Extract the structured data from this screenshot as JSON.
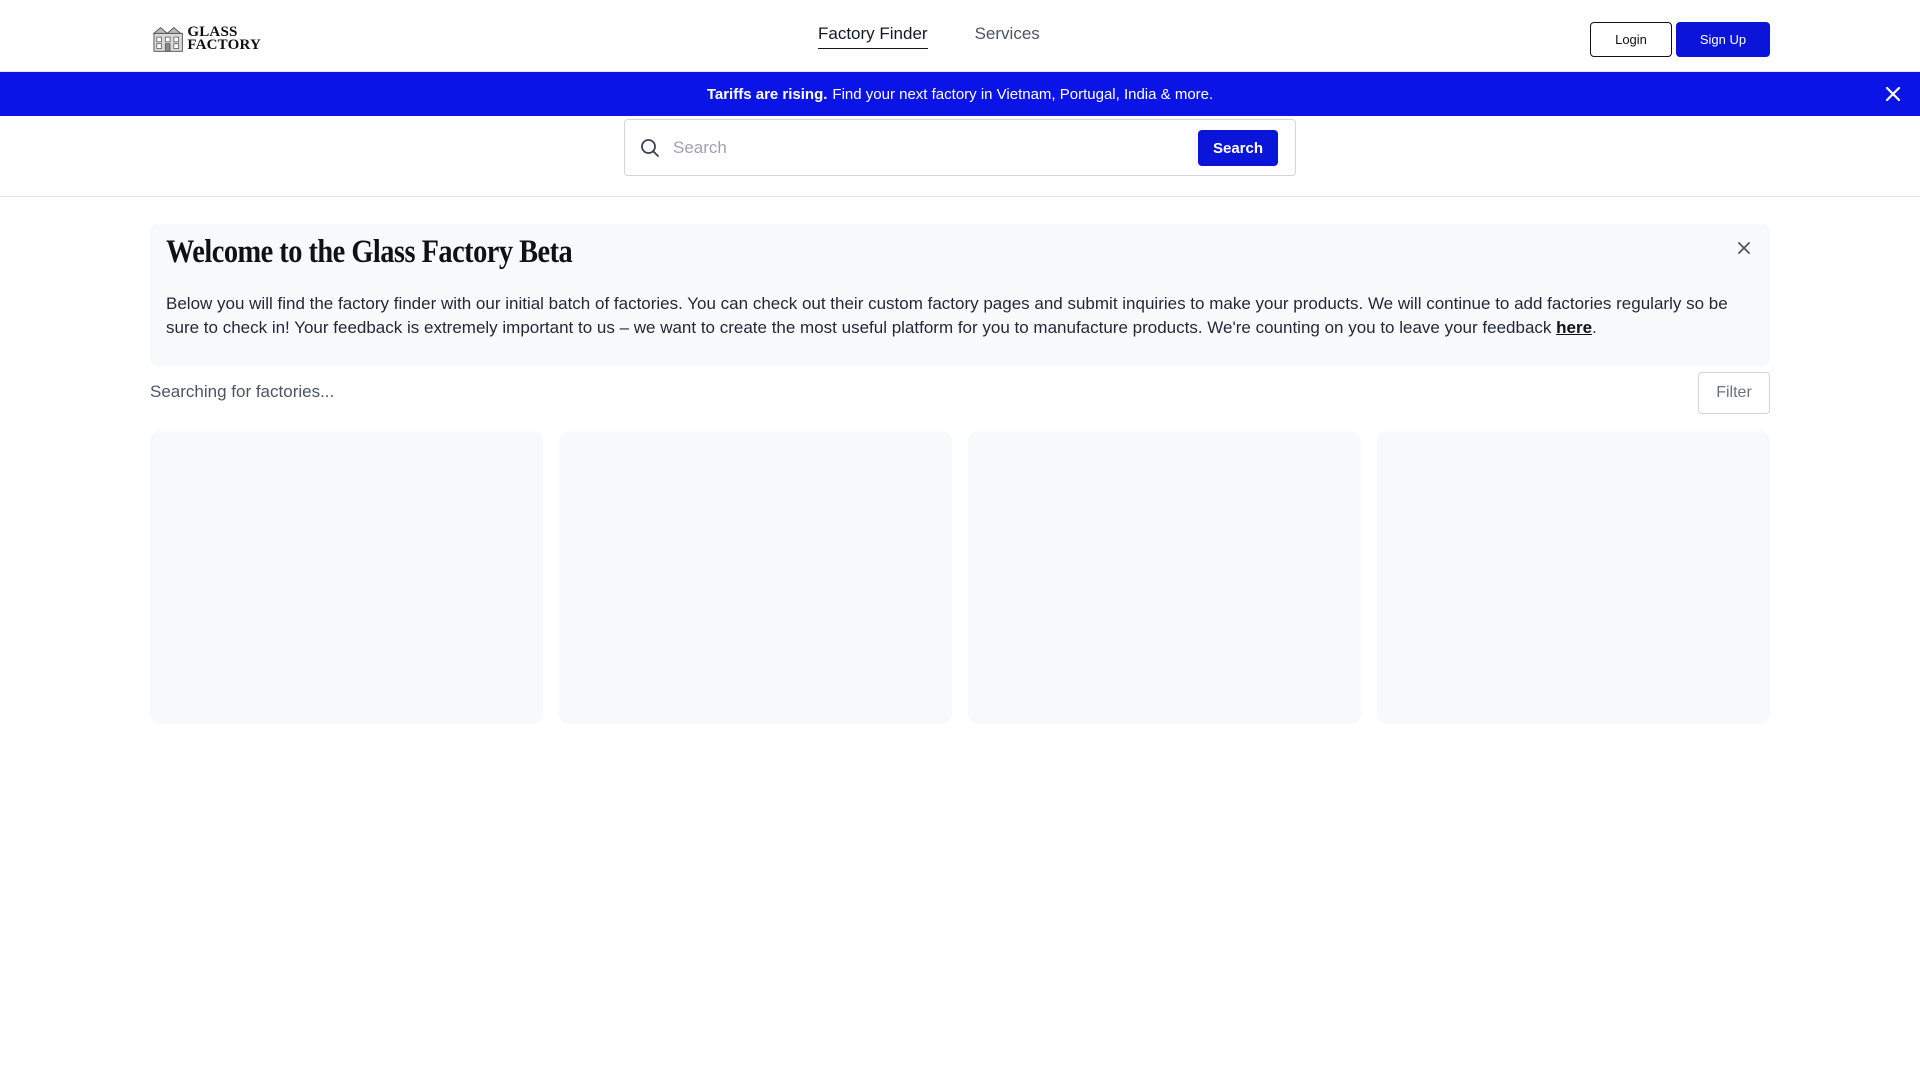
{
  "header": {
    "logo": {
      "line1": "GLASS",
      "line2": "FACTORY"
    },
    "nav": [
      {
        "label": "Factory Finder",
        "active": true
      },
      {
        "label": "Services",
        "active": false
      }
    ],
    "login_label": "Login",
    "signup_label": "Sign Up"
  },
  "banner": {
    "bold": "Tariffs are rising.",
    "text": "Find your next factory in Vietnam, Portugal, India & more.",
    "close_icon": "close-icon"
  },
  "search": {
    "placeholder": "Search",
    "value": "",
    "button_label": "Search",
    "icon": "search-icon"
  },
  "welcome": {
    "title": "Welcome to the Glass Factory Beta",
    "body": "Below you will find the factory finder with our initial batch of factories. You can check out their custom factory pages and submit inquiries to make your products. We will continue to add factories regularly so be sure to check in! Your feedback is extremely important to us – we want to create the most useful platform for you to manufacture products. We're counting on you to leave your feedback ",
    "link_label": "here",
    "trailing": "."
  },
  "results": {
    "status": "Searching for factories...",
    "filter_label": "Filter"
  },
  "colors": {
    "accent": "#0b14d9",
    "banner_bg": "#0b14e6",
    "card_bg": "#f8f9fb"
  }
}
